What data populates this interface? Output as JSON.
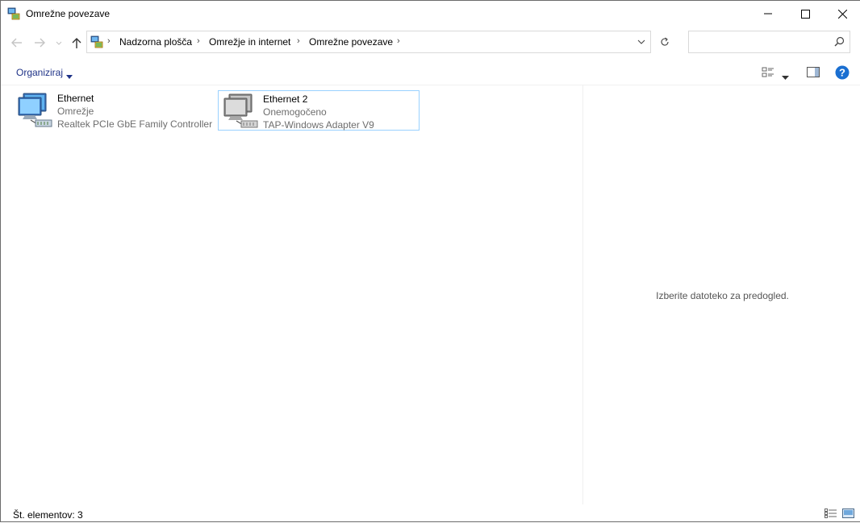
{
  "window": {
    "title": "Omrežne povezave",
    "icon": "network-connections-icon"
  },
  "controls": {
    "minimize_icon": "minimize-icon",
    "maximize_icon": "maximize-icon",
    "close_icon": "close-icon"
  },
  "navigation": {
    "back_icon": "arrow-left-icon",
    "forward_icon": "arrow-right-icon",
    "recent_icon": "chevron-down-icon",
    "up_icon": "arrow-up-icon"
  },
  "address": {
    "breadcrumbs": [
      "Nadzorna plošča",
      "Omrežje in internet",
      "Omrežne povezave"
    ],
    "refresh_icon": "refresh-icon",
    "dropdown_icon": "chevron-down-icon"
  },
  "search": {
    "placeholder": "",
    "icon": "search-icon"
  },
  "toolbar": {
    "organize_label": "Organiziraj",
    "view_options_icon": "change-view-icon",
    "preview_pane_icon": "preview-pane-icon",
    "help_icon": "help-icon"
  },
  "items": [
    {
      "name": "Ethernet",
      "status": "Omrežje",
      "device": "Realtek PCIe GbE Family Controller",
      "icon": "network-adapter-icon",
      "enabled": true
    },
    {
      "name": "Ethernet 2",
      "status": "Onemogočeno",
      "device": "TAP-Windows Adapter V9",
      "icon": "network-adapter-disabled-icon",
      "enabled": false
    }
  ],
  "preview": {
    "message": "Izberite datoteko za predogled."
  },
  "status": {
    "item_count": "Št. elementov: 3",
    "details_view_icon": "details-view-icon",
    "large_icons_view_icon": "large-icons-view-icon"
  },
  "colors": {
    "accent": "#0078d7",
    "selection_border": "#99d1ff",
    "organize_text": "#1e3287",
    "help": "#1a6fd1"
  }
}
